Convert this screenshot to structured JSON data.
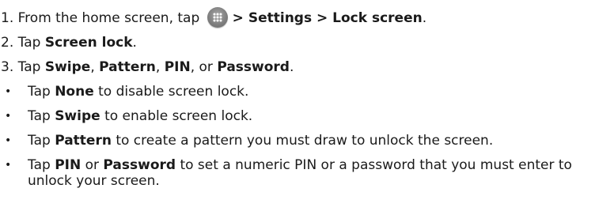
{
  "steps": [
    {
      "number": "1.",
      "pre": "From the home screen, tap",
      "icon": "apps-grid-icon",
      "post": "> Settings > Lock screen",
      "end": "."
    },
    {
      "number": "2.",
      "pre": "Tap ",
      "bold": "Screen lock",
      "end": "."
    },
    {
      "number": "3.",
      "pre": "Tap ",
      "b1": "Swipe",
      "s1": ", ",
      "b2": "Pattern",
      "s2": ", ",
      "b3": "PIN",
      "s3": ", or ",
      "b4": "Password",
      "end": "."
    }
  ],
  "bullets": [
    {
      "marker": "•",
      "pre": "Tap ",
      "bold": "None",
      "post": " to disable screen lock."
    },
    {
      "marker": "•",
      "pre": "Tap ",
      "bold": "Swipe",
      "post": " to enable screen lock."
    },
    {
      "marker": "•",
      "pre": "Tap ",
      "bold": "Pattern",
      "post": " to create a pattern you must draw to unlock the screen."
    },
    {
      "marker": "•",
      "pre": "Tap ",
      "bold": "PIN",
      "mid": " or ",
      "bold2": "Password",
      "post": " to set a numeric PIN or a password that you must enter to unlock your screen."
    }
  ]
}
